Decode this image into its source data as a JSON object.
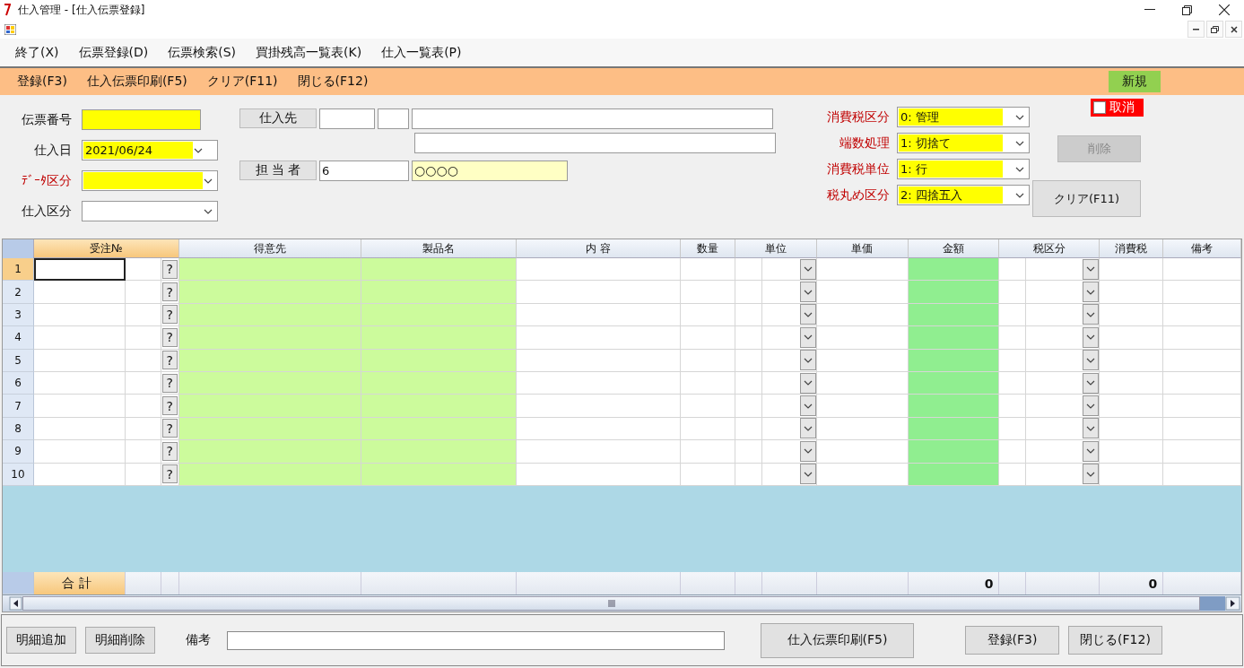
{
  "window": {
    "title": "仕入管理 - [仕入伝票登録]"
  },
  "menu": [
    "終了(X)",
    "伝票登録(D)",
    "伝票検索(S)",
    "買掛残高一覧表(K)",
    "仕入一覧表(P)"
  ],
  "toolbar": [
    "登録(F3)",
    "仕入伝票印刷(F5)",
    "クリア(F11)",
    "閉じる(F12)"
  ],
  "mode_badge": {
    "label": "新規"
  },
  "cancel_check": {
    "label": "取消",
    "checked": false
  },
  "left_fields": [
    {
      "label": "伝票番号",
      "kind": "text",
      "required": false,
      "highlighted": true
    },
    {
      "label": "仕入日",
      "kind": "combo",
      "value": "2021/06/24",
      "required": false,
      "highlighted": true
    },
    {
      "label": "ﾃﾞｰﾀ区分",
      "kind": "combo",
      "required": true,
      "highlighted": true
    },
    {
      "label": "仕入区分",
      "kind": "combo",
      "required": false,
      "highlighted": false
    }
  ],
  "supplier": {
    "label": "仕入先"
  },
  "staff": {
    "label": "担 当 者",
    "code": "6",
    "name": "○○○○"
  },
  "tax_settings": [
    {
      "label": "消費税区分",
      "value": "0: 管理",
      "required": true,
      "highlighted": true
    },
    {
      "label": "端数処理",
      "value": "1: 切捨て",
      "required": true,
      "highlighted": true
    },
    {
      "label": "消費税単位",
      "value": "1: 行",
      "required": true,
      "highlighted": true
    },
    {
      "label": "税丸め区分",
      "value": "2: 四捨五入",
      "required": true,
      "highlighted": true
    }
  ],
  "side_buttons": [
    {
      "label": "削除",
      "disabled": true
    },
    {
      "label": "クリア(F11)",
      "disabled": false
    }
  ],
  "grid": {
    "columns": [
      {
        "label": "受注№",
        "kind": "code",
        "selected": true
      },
      {
        "label": "得意先",
        "kind": "readonly",
        "selected": false
      },
      {
        "label": "製品名",
        "kind": "readonly",
        "selected": false
      },
      {
        "label": "内 容",
        "kind": "text",
        "selected": false
      },
      {
        "label": "数量",
        "kind": "text",
        "selected": false
      },
      {
        "label": "単位",
        "kind": "combo",
        "selected": false
      },
      {
        "label": "単価",
        "kind": "text",
        "selected": false
      },
      {
        "label": "金額",
        "kind": "computed",
        "selected": false,
        "total": "0"
      },
      {
        "label": "税区分",
        "kind": "combo",
        "selected": false
      },
      {
        "label": "消費税",
        "kind": "text",
        "selected": false,
        "total": "0"
      },
      {
        "label": "備考",
        "kind": "text",
        "selected": false
      }
    ],
    "rows": [
      {
        "number": "1",
        "selected": true,
        "lookup": "?"
      },
      {
        "number": "2",
        "selected": false,
        "lookup": "?"
      },
      {
        "number": "3",
        "selected": false,
        "lookup": "?"
      },
      {
        "number": "4",
        "selected": false,
        "lookup": "?"
      },
      {
        "number": "5",
        "selected": false,
        "lookup": "?"
      },
      {
        "number": "6",
        "selected": false,
        "lookup": "?"
      },
      {
        "number": "7",
        "selected": false,
        "lookup": "?"
      },
      {
        "number": "8",
        "selected": false,
        "lookup": "?"
      },
      {
        "number": "9",
        "selected": false,
        "lookup": "?"
      },
      {
        "number": "10",
        "selected": false,
        "lookup": "?"
      }
    ],
    "total_label": "合 計"
  },
  "bottom": {
    "left_buttons": [
      "明細追加",
      "明細削除"
    ],
    "remark_label": "備考",
    "print_button": "仕入伝票印刷(F5)",
    "right_buttons": [
      "登録(F3)",
      "閉じる(F12)"
    ]
  }
}
